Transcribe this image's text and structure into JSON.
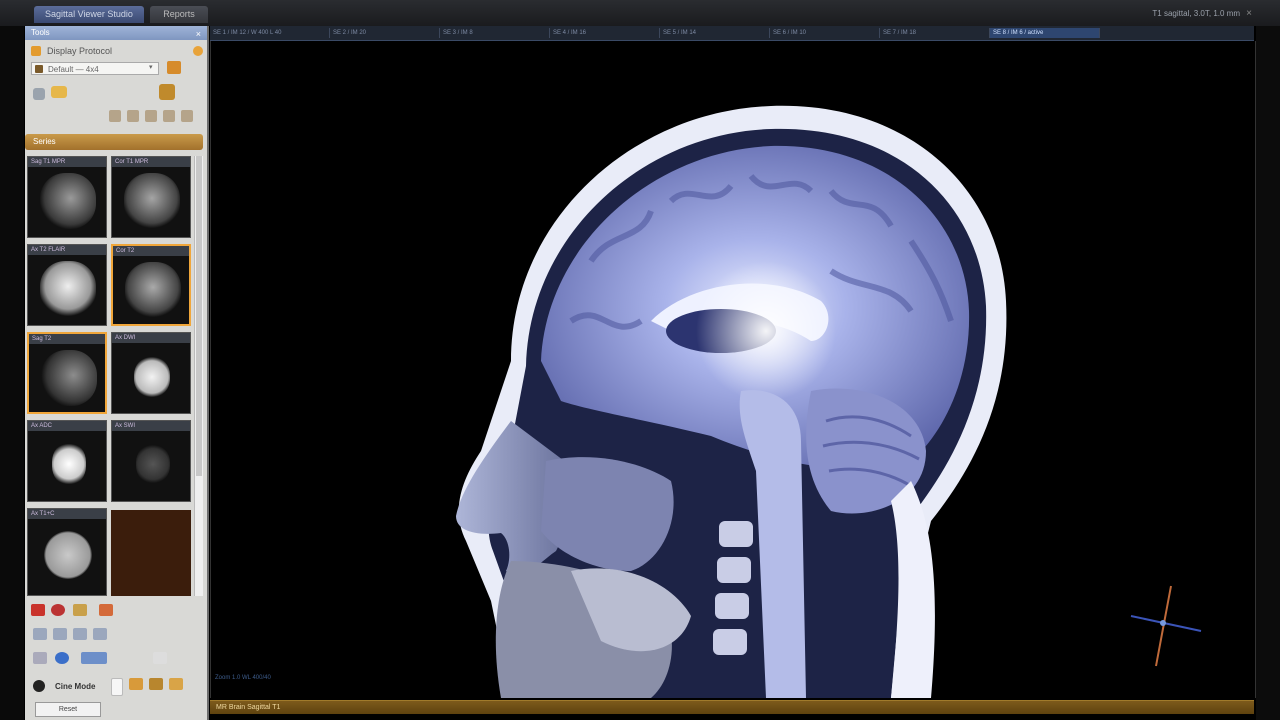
{
  "window": {
    "tabs": [
      {
        "label": "Sagittal Viewer Studio"
      },
      {
        "label": "Reports"
      }
    ],
    "status_text": "T1 sagittal, 3.0T, 1.0 mm",
    "close_glyph": "×"
  },
  "panel": {
    "title": "Tools",
    "close_glyph": "×",
    "display_label": "Display Protocol",
    "preset_value": "Default — 4x4",
    "preset_dropdown_glyph": "▾",
    "series_title": "Series",
    "thumbnails": [
      {
        "label": "Sag T1 MPR"
      },
      {
        "label": "Cor T1 MPR"
      },
      {
        "label": "Ax T2 FLAIR"
      },
      {
        "label": "Cor T2"
      },
      {
        "label": "Sag T2"
      },
      {
        "label": "Ax DWI"
      },
      {
        "label": "Ax ADC"
      },
      {
        "label": "Ax SWI"
      },
      {
        "label": "Ax T1+C"
      }
    ],
    "play_label": "Cine Mode",
    "footer_button": "Reset"
  },
  "ruler": {
    "cells": [
      {
        "label": "SE 1 / IM 12 / W 400 L 40"
      },
      {
        "label": "SE 2 / IM 20"
      },
      {
        "label": "SE 3 / IM 8"
      },
      {
        "label": "SE 4 / IM 16"
      },
      {
        "label": "SE 5 / IM 14"
      },
      {
        "label": "SE 6 / IM 10"
      },
      {
        "label": "SE 7 / IM 18"
      },
      {
        "label": "SE 8 / IM 6 / active"
      }
    ]
  },
  "viewport": {
    "hint": "Zoom 1.0  WL 400/40",
    "image_subject": "mid-sagittal brain MRI"
  },
  "statusbar": {
    "text": "MR  Brain  Sagittal T1"
  },
  "colors": {
    "accent": "#f0a63a",
    "mri_tint": "#9aa6e6",
    "status_bar": "#7d5a1b"
  }
}
